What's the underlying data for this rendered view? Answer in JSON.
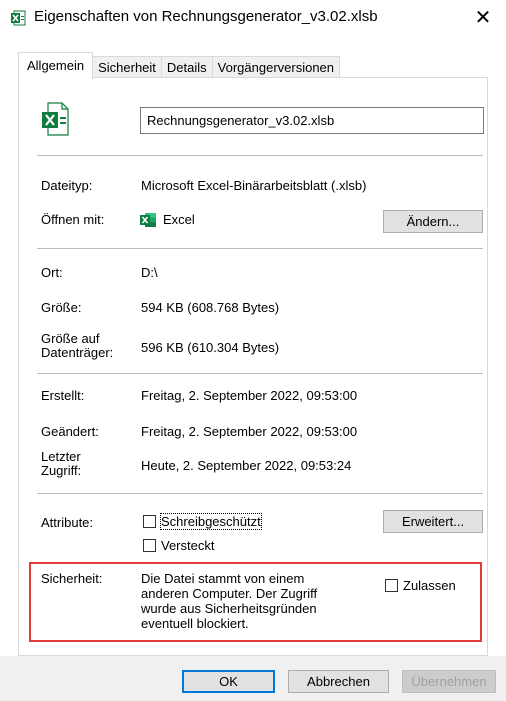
{
  "window": {
    "title": "Eigenschaften von Rechnungsgenerator_v3.02.xlsb",
    "close_glyph": "✕",
    "icon": "excel-file-icon"
  },
  "tabs": [
    {
      "label": "Allgemein",
      "active": true
    },
    {
      "label": "Sicherheit",
      "active": false
    },
    {
      "label": "Details",
      "active": false
    },
    {
      "label": "Vorgängerversionen",
      "active": false
    }
  ],
  "general": {
    "filename": "Rechnungsgenerator_v3.02.xlsb",
    "filetype_label": "Dateityp:",
    "filetype_value": "Microsoft Excel-Binärarbeitsblatt (.xlsb)",
    "openwith_label": "Öffnen mit:",
    "openwith_value": "Excel",
    "change_button": "Ändern...",
    "location_label": "Ort:",
    "location_value": "D:\\",
    "size_label": "Größe:",
    "size_value": "594 KB (608.768 Bytes)",
    "disksize_label": "Größe auf\nDatenträger:",
    "disksize_value": "596 KB (610.304 Bytes)",
    "created_label": "Erstellt:",
    "created_value": "Freitag, 2. September 2022, 09:53:00",
    "modified_label": "Geändert:",
    "modified_value": "Freitag, 2. September 2022, 09:53:00",
    "accessed_label": "Letzter\nZugriff:",
    "accessed_value": "Heute, 2. September 2022, 09:53:24",
    "attributes_label": "Attribute:",
    "readonly_label": "Schreibgeschützt",
    "readonly_checked": false,
    "hidden_label": "Versteckt",
    "hidden_checked": false,
    "advanced_button": "Erweitert...",
    "security_label": "Sicherheit:",
    "security_text": "Die Datei stammt von einem\nanderen Computer. Der Zugriff\nwurde aus Sicherheitsgründen\neventuell blockiert.",
    "unblock_label": "Zulassen",
    "unblock_checked": false
  },
  "footer": {
    "ok": "OK",
    "cancel": "Abbrechen",
    "apply": "Übernehmen"
  },
  "colors": {
    "excel_green": "#107c41",
    "highlight_red": "#e33a3a",
    "primary_blue": "#0078d7"
  }
}
